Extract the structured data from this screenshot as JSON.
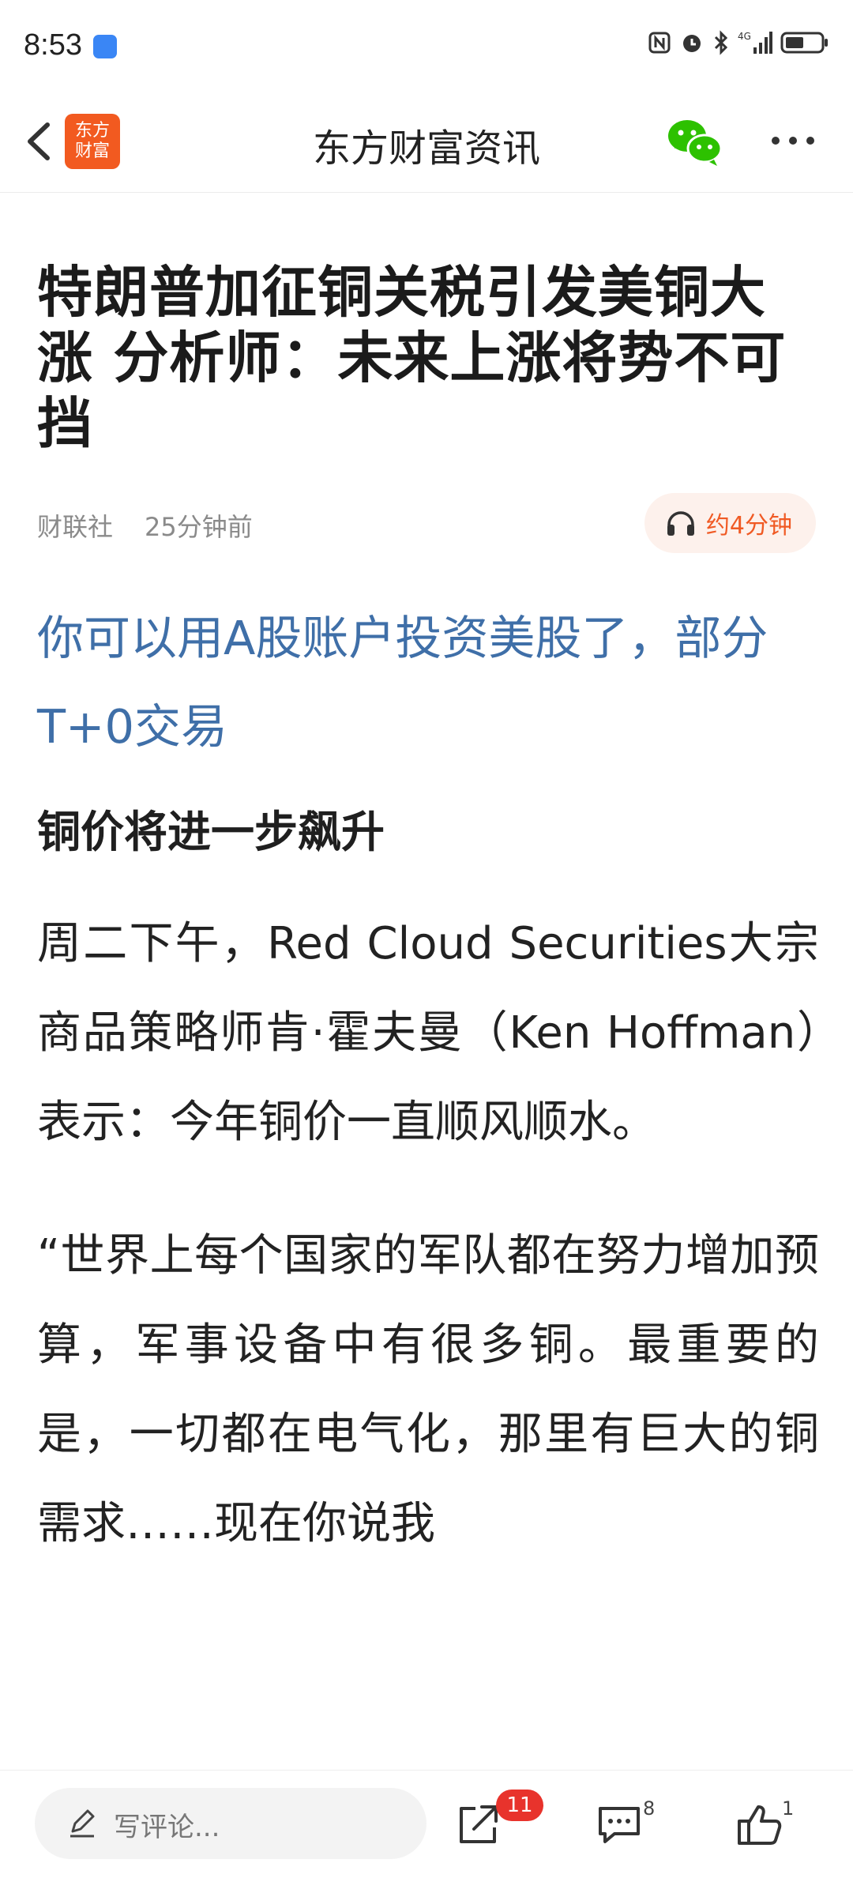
{
  "status_bar": {
    "time": "8:53"
  },
  "nav": {
    "brand_line1": "东方",
    "brand_line2": "财富",
    "title": "东方财富资讯"
  },
  "article": {
    "headline": "特朗普加征铜关税引发美铜大涨 分析师：未来上涨将势不可挡",
    "source": "财联社",
    "time": "25分钟前",
    "listen_label": "约4分钟",
    "promo_link": "你可以用A股账户投资美股了，部分T+0交易",
    "subheading": "铜价将进一步飙升",
    "paragraph1": "周二下午，Red Cloud Securities大宗商品策略师肯·霍夫曼（Ken Hoffman）表示：今年铜价一直顺风顺水。",
    "paragraph2": "“世界上每个国家的军队都在努力增加预算，军事设备中有很多铜。最重要的是，一切都在电气化，那里有巨大的铜需求……现在你说我"
  },
  "bottom_bar": {
    "comment_placeholder": "写评论...",
    "share_badge": "11",
    "comment_count": "8",
    "like_count": "1"
  },
  "colors": {
    "brand": "#f25a20",
    "link": "#3f6fa8",
    "accent": "#f05a24",
    "badge": "#e8332c",
    "wechat": "#2dc100"
  },
  "icons": [
    "back-arrow-icon",
    "wechat-icon",
    "more-icon",
    "headphones-icon",
    "pencil-icon",
    "share-icon",
    "comment-icon",
    "like-icon"
  ]
}
